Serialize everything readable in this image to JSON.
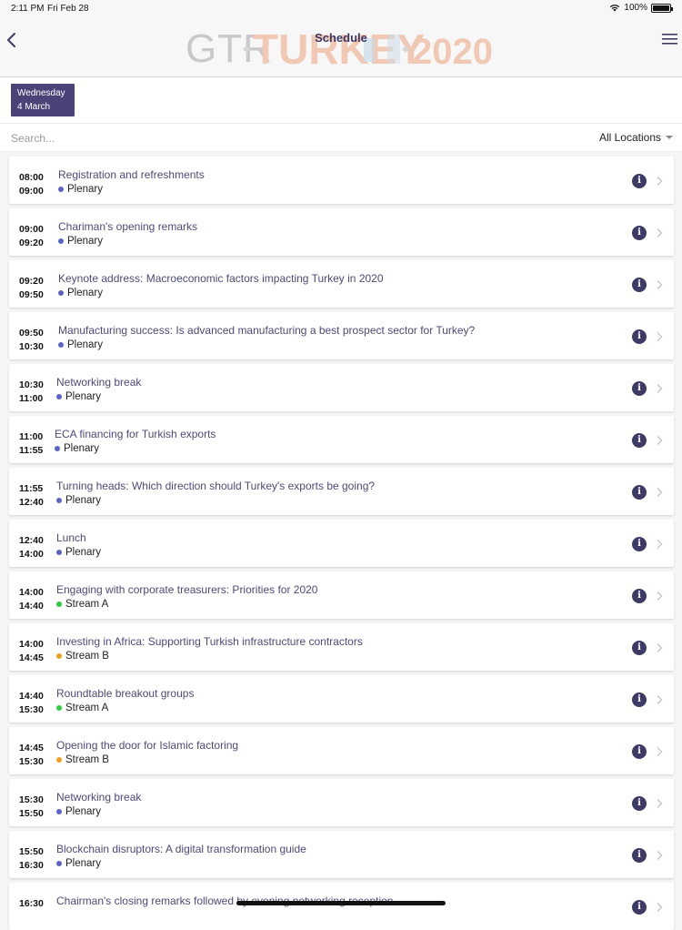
{
  "status_bar": {
    "time": "2:11 PM",
    "date": "Fri Feb 28",
    "battery": "100%"
  },
  "nav": {
    "title": "Schedule",
    "logo_left": "GTR",
    "logo_mid": "TURKEY",
    "logo_right": "2020"
  },
  "date_tab": {
    "weekday": "Wednesday",
    "day": "4 March"
  },
  "search": {
    "placeholder": "Search...",
    "value": ""
  },
  "location_filter": {
    "label": "All Locations"
  },
  "colors": {
    "accent": "#4a4378",
    "plenary": "#5a63c4",
    "stream_a": "#2ecc40",
    "stream_b": "#f0a020"
  },
  "sessions": [
    {
      "start": "08:00",
      "end": "09:00",
      "title": "Registration and refreshments",
      "location": "Plenary",
      "dot_color": "#5a63c4"
    },
    {
      "start": "09:00",
      "end": "09:20",
      "title": "Chariman's opening remarks",
      "location": "Plenary",
      "dot_color": "#5a63c4"
    },
    {
      "start": "09:20",
      "end": "09:50",
      "title": "Keynote address: Macroeconomic factors impacting Turkey in 2020",
      "location": "Plenary",
      "dot_color": "#5a63c4"
    },
    {
      "start": "09:50",
      "end": "10:30",
      "title": "Manufacturing success: Is advanced manufacturing a best prospect sector for Turkey?",
      "location": "Plenary",
      "dot_color": "#5a63c4"
    },
    {
      "start": "10:30",
      "end": "11:00",
      "title": "Networking break",
      "location": "Plenary",
      "dot_color": "#5a63c4"
    },
    {
      "start": "11:00",
      "end": "11:55",
      "title": "ECA financing for Turkish exports",
      "location": "Plenary",
      "dot_color": "#5a63c4"
    },
    {
      "start": "11:55",
      "end": "12:40",
      "title": "Turning heads: Which direction should Turkey's exports be going?",
      "location": "Plenary",
      "dot_color": "#5a63c4"
    },
    {
      "start": "12:40",
      "end": "14:00",
      "title": "Lunch",
      "location": "Plenary",
      "dot_color": "#5a63c4"
    },
    {
      "start": "14:00",
      "end": "14:40",
      "title": "Engaging with corporate treasurers: Priorities for 2020",
      "location": "Stream A",
      "dot_color": "#2ecc40"
    },
    {
      "start": "14:00",
      "end": "14:45",
      "title": "Investing in Africa: Supporting Turkish infrastructure contractors",
      "location": "Stream B",
      "dot_color": "#f0a020"
    },
    {
      "start": "14:40",
      "end": "15:30",
      "title": "Roundtable breakout groups",
      "location": "Stream A",
      "dot_color": "#2ecc40"
    },
    {
      "start": "14:45",
      "end": "15:30",
      "title": "Opening the door for Islamic factoring",
      "location": "Stream B",
      "dot_color": "#f0a020"
    },
    {
      "start": "15:30",
      "end": "15:50",
      "title": "Networking break",
      "location": "Plenary",
      "dot_color": "#5a63c4"
    },
    {
      "start": "15:50",
      "end": "16:30",
      "title": "Blockchain disruptors: A digital transformation guide",
      "location": "Plenary",
      "dot_color": "#5a63c4"
    },
    {
      "start": "16:30",
      "end": "",
      "title": "Chairman's closing remarks followed by evening networking reception",
      "location": "",
      "dot_color": "#5a63c4"
    }
  ]
}
